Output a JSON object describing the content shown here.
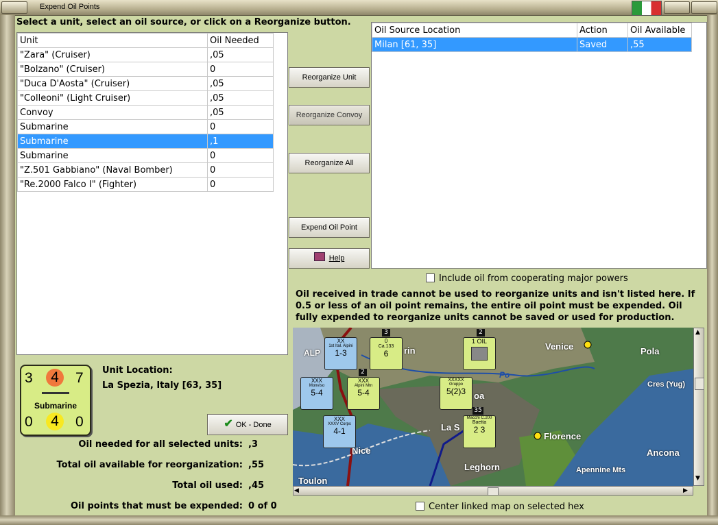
{
  "window": {
    "title": "Expend Oil Points"
  },
  "instruction": "Select a unit, select an oil source, or click on a Reorganize button.",
  "units_table": {
    "headers": [
      "Unit",
      "Oil Needed"
    ],
    "rows": [
      [
        "\"Zara\" (Cruiser)",
        ",05"
      ],
      [
        "\"Bolzano\" (Cruiser)",
        "0"
      ],
      [
        "\"Duca D'Aosta\" (Cruiser)",
        ",05"
      ],
      [
        "\"Colleoni\" (Light Cruiser)",
        ",05"
      ],
      [
        "Convoy",
        ",05"
      ],
      [
        "Submarine",
        "0"
      ],
      [
        "Submarine",
        ",1"
      ],
      [
        "Submarine",
        "0"
      ],
      [
        "\"Z.501 Gabbiano\" (Naval Bomber)",
        "0"
      ],
      [
        "\"Re.2000 Falco I\" (Fighter)",
        "0"
      ]
    ],
    "selected_row": 6
  },
  "sources_table": {
    "headers": [
      "Oil Source Location",
      "Action",
      "Oil Available"
    ],
    "rows": [
      [
        "Milan [61, 35]",
        "Saved",
        ",55"
      ]
    ],
    "selected_row": 0
  },
  "buttons": {
    "reorganize_unit": "Reorganize Unit",
    "reorganize_convoy": "Reorganize Convoy",
    "reorganize_all": "Reorganize All",
    "expend_oil_point": "Expend Oil Point",
    "help": "Help",
    "ok_done": "OK - Done"
  },
  "include_oil_checkbox": {
    "label": "Include oil from cooperating major powers",
    "checked": false
  },
  "notice": "Oil received in trade cannot be used to reorganize units and isn't listed here.  If 0.5 or less of an oil point remains, the entire oil point must be expended.   Oil fully expended to reorganize units cannot be saved or used for production.",
  "unit_counter": {
    "top_left": "3",
    "top_mid": "4",
    "top_right": "7",
    "name": "Submarine",
    "bot_left": "0",
    "bot_mid": "4",
    "bot_right": "0"
  },
  "unit_location": {
    "label": "Unit Location:",
    "value": "La Spezia, Italy [63, 35]"
  },
  "stats": [
    {
      "label": "Oil needed for all selected units:",
      "value": ",3"
    },
    {
      "label": "Total oil available for reorganization:",
      "value": ",55"
    },
    {
      "label": "Total oil used:",
      "value": ",45"
    },
    {
      "label": "Oil points that must be expended:",
      "value": "0 of 0"
    }
  ],
  "center_map_checkbox": {
    "label": "Center linked map on selected hex",
    "checked": false
  },
  "map": {
    "labels": [
      "Venice",
      "Pola",
      "Cres (Yug)",
      "Florence",
      "Ancona",
      "Leghorn",
      "Apennine Mts",
      "Nice",
      "Toulon",
      "La S",
      "Po",
      "ALP",
      "rin",
      "oa"
    ],
    "counters": [
      {
        "top": "XX",
        "name": "1st Ital. Alpini",
        "value": "1-3"
      },
      {
        "top": "0",
        "name": "Ca.133",
        "value": "6"
      },
      {
        "top": "1 OIL",
        "name": "",
        "value": ""
      },
      {
        "top": "XXX",
        "name": "Monviso",
        "value": "5-4"
      },
      {
        "top": "XXX",
        "name": "Alpini Mtn",
        "value": "5-4"
      },
      {
        "top": "XXXXX",
        "name": "Gruppo",
        "value": "5(2)3"
      },
      {
        "top": "XXX",
        "name": "XXXV Corps",
        "value": "4-1"
      },
      {
        "top": "Macchi C.200",
        "name": "Baetta",
        "value": "2  3"
      }
    ],
    "badges": [
      "3",
      "2",
      "2",
      "35"
    ]
  },
  "colors": {
    "background": "#cdd8a4",
    "selection": "#3399ff",
    "counter_bg": "#d8ec86",
    "orange": "#f0783c",
    "yellow": "#f8e820"
  }
}
